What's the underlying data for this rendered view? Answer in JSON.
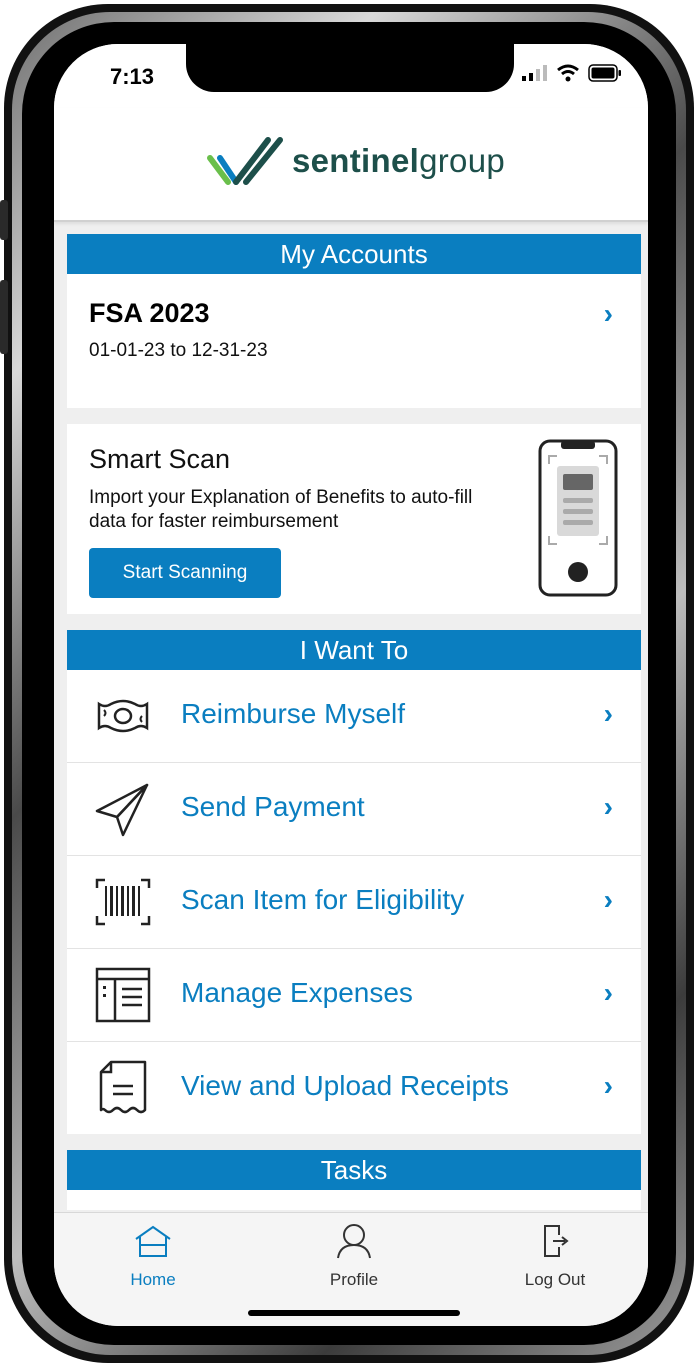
{
  "status_bar": {
    "time": "7:13"
  },
  "header": {
    "brand_bold": "sentinel",
    "brand_light": "group"
  },
  "accounts": {
    "title": "My Accounts",
    "items": [
      {
        "name": "FSA 2023",
        "dates": "01-01-23 to 12-31-23"
      }
    ]
  },
  "smart_scan": {
    "title": "Smart Scan",
    "description": "Import your Explanation of Benefits to auto-fill data for faster reimbursement",
    "button": "Start Scanning"
  },
  "i_want_to": {
    "title": "I Want To",
    "items": [
      {
        "label": "Reimburse Myself",
        "icon": "money-icon"
      },
      {
        "label": "Send Payment",
        "icon": "paper-plane-icon"
      },
      {
        "label": "Scan Item for Eligibility",
        "icon": "barcode-icon"
      },
      {
        "label": "Manage Expenses",
        "icon": "expenses-icon"
      },
      {
        "label": "View and Upload Receipts",
        "icon": "receipt-icon"
      }
    ]
  },
  "tasks": {
    "title": "Tasks"
  },
  "tab_bar": {
    "items": [
      {
        "label": "Home",
        "icon": "home-icon",
        "active": true
      },
      {
        "label": "Profile",
        "icon": "profile-icon",
        "active": false
      },
      {
        "label": "Log Out",
        "icon": "logout-icon",
        "active": false
      }
    ]
  },
  "colors": {
    "accent": "#0a7ec0",
    "brand_text": "#1d4f4a",
    "tab_active": "#0a7ec0"
  }
}
